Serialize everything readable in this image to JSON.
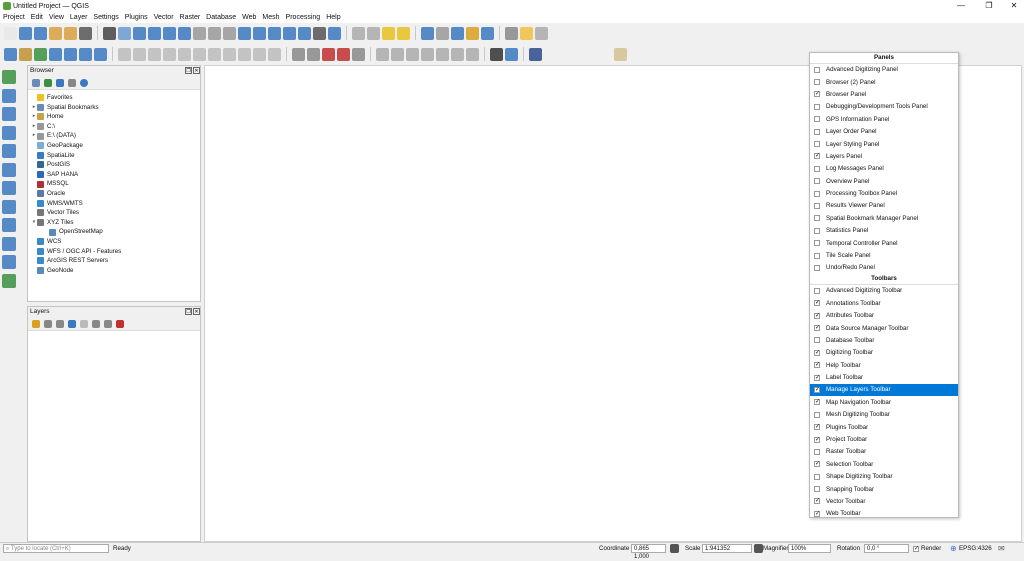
{
  "window": {
    "title": "Untitled Project — QGIS",
    "min": "—",
    "max": "❐",
    "close": "✕"
  },
  "menu": [
    "Project",
    "Edit",
    "View",
    "Layer",
    "Settings",
    "Plugins",
    "Vector",
    "Raster",
    "Database",
    "Web",
    "Mesh",
    "Processing",
    "Help"
  ],
  "browser": {
    "title": "Browser",
    "items": [
      {
        "label": "Favorites",
        "icon": "star-icon",
        "color": "#f0c020",
        "indent": 0,
        "arrow": ""
      },
      {
        "label": "Spatial Bookmarks",
        "icon": "bookmark-icon",
        "color": "#6a8ab8",
        "indent": 0,
        "arrow": "▸"
      },
      {
        "label": "Home",
        "icon": "home-folder-icon",
        "color": "#c8a050",
        "indent": 0,
        "arrow": "▸"
      },
      {
        "label": "C:\\",
        "icon": "drive-icon",
        "color": "#999999",
        "indent": 0,
        "arrow": "▸"
      },
      {
        "label": "E:\\ (DATA)",
        "icon": "drive-icon",
        "color": "#999999",
        "indent": 0,
        "arrow": "▸"
      },
      {
        "label": "GeoPackage",
        "icon": "geopackage-icon",
        "color": "#7ab0d8",
        "indent": 0,
        "arrow": ""
      },
      {
        "label": "SpatiaLite",
        "icon": "spatialite-icon",
        "color": "#3a7abf",
        "indent": 0,
        "arrow": ""
      },
      {
        "label": "PostGIS",
        "icon": "postgis-icon",
        "color": "#336791",
        "indent": 0,
        "arrow": ""
      },
      {
        "label": "SAP HANA",
        "icon": "sap-hana-icon",
        "color": "#2a6ab8",
        "indent": 0,
        "arrow": ""
      },
      {
        "label": "MSSQL",
        "icon": "mssql-icon",
        "color": "#b03030",
        "indent": 0,
        "arrow": ""
      },
      {
        "label": "Oracle",
        "icon": "oracle-icon",
        "color": "#5a7aa8",
        "indent": 0,
        "arrow": ""
      },
      {
        "label": "WMS/WMTS",
        "icon": "wms-icon",
        "color": "#3a8ac8",
        "indent": 0,
        "arrow": ""
      },
      {
        "label": "Vector Tiles",
        "icon": "vector-tiles-icon",
        "color": "#777777",
        "indent": 0,
        "arrow": ""
      },
      {
        "label": "XYZ Tiles",
        "icon": "xyz-tiles-icon",
        "color": "#777777",
        "indent": 0,
        "arrow": "▾"
      },
      {
        "label": "OpenStreetMap",
        "icon": "tile-icon",
        "color": "#5a8ab8",
        "indent": 1,
        "arrow": ""
      },
      {
        "label": "WCS",
        "icon": "wcs-icon",
        "color": "#3a8ac8",
        "indent": 0,
        "arrow": ""
      },
      {
        "label": "WFS / OGC API - Features",
        "icon": "wfs-icon",
        "color": "#3a8ac8",
        "indent": 0,
        "arrow": ""
      },
      {
        "label": "ArcGIS REST Servers",
        "icon": "arcgis-icon",
        "color": "#3a8ac8",
        "indent": 0,
        "arrow": ""
      },
      {
        "label": "GeoNode",
        "icon": "geonode-icon",
        "color": "#5a8ab8",
        "indent": 0,
        "arrow": ""
      }
    ]
  },
  "layers": {
    "title": "Layers"
  },
  "panels": {
    "header": "Panels",
    "items": [
      {
        "label": "Advanced Digitizing Panel",
        "checked": false
      },
      {
        "label": "Browser (2) Panel",
        "checked": false
      },
      {
        "label": "Browser Panel",
        "checked": true
      },
      {
        "label": "Debugging/Development Tools Panel",
        "checked": false
      },
      {
        "label": "GPS Information Panel",
        "checked": false
      },
      {
        "label": "Layer Order Panel",
        "checked": false
      },
      {
        "label": "Layer Styling Panel",
        "checked": false
      },
      {
        "label": "Layers Panel",
        "checked": true
      },
      {
        "label": "Log Messages Panel",
        "checked": false
      },
      {
        "label": "Overview Panel",
        "checked": false
      },
      {
        "label": "Processing Toolbox Panel",
        "checked": false
      },
      {
        "label": "Results Viewer Panel",
        "checked": false
      },
      {
        "label": "Spatial Bookmark Manager Panel",
        "checked": false
      },
      {
        "label": "Statistics Panel",
        "checked": false
      },
      {
        "label": "Temporal Controller Panel",
        "checked": false
      },
      {
        "label": "Tile Scale Panel",
        "checked": false
      },
      {
        "label": "Undo/Redo Panel",
        "checked": false
      }
    ]
  },
  "toolbars": {
    "header": "Toolbars",
    "items": [
      {
        "label": "Advanced Digitizing Toolbar",
        "checked": false
      },
      {
        "label": "Annotations Toolbar",
        "checked": true
      },
      {
        "label": "Attributes Toolbar",
        "checked": true
      },
      {
        "label": "Data Source Manager Toolbar",
        "checked": true
      },
      {
        "label": "Database Toolbar",
        "checked": false
      },
      {
        "label": "Digitizing Toolbar",
        "checked": true
      },
      {
        "label": "Help Toolbar",
        "checked": true
      },
      {
        "label": "Label Toolbar",
        "checked": true
      },
      {
        "label": "Manage Layers Toolbar",
        "checked": true,
        "highlight": true
      },
      {
        "label": "Map Navigation Toolbar",
        "checked": true
      },
      {
        "label": "Mesh Digitizing Toolbar",
        "checked": false
      },
      {
        "label": "Plugins Toolbar",
        "checked": true
      },
      {
        "label": "Project Toolbar",
        "checked": true
      },
      {
        "label": "Raster Toolbar",
        "checked": false
      },
      {
        "label": "Selection Toolbar",
        "checked": true
      },
      {
        "label": "Shape Digitizing Toolbar",
        "checked": false
      },
      {
        "label": "Snapping Toolbar",
        "checked": false
      },
      {
        "label": "Vector Toolbar",
        "checked": true
      },
      {
        "label": "Web Toolbar",
        "checked": true
      }
    ]
  },
  "status": {
    "search_placeholder": "Type to locate (Ctrl+K)",
    "ready": "Ready",
    "coord_label": "Coordinate",
    "coord": "0,865 1,000",
    "scale_label": "Scale",
    "scale": "1:941352",
    "magnifier_label": "Magnifier",
    "magnifier": "100%",
    "rotation_label": "Rotation",
    "rotation": "0,0 °",
    "render_label": "Render",
    "crs": "EPSG:4326"
  },
  "toolbar1": [
    "#e8e8e8",
    "#3a78c0",
    "#3a78c0",
    "#d8a040",
    "#d8a040",
    "#555555",
    "sep",
    "#444444",
    "#6a9ad0",
    "#3a78c0",
    "#3a78c0",
    "#3a78c0",
    "#3a78c0",
    "#999999",
    "#999999",
    "#999999",
    "#3a78c0",
    "#3a78c0",
    "#3a78c0",
    "#3a78c0",
    "#3a78c0",
    "#555555",
    "#3a78c0",
    "sep",
    "#aaaaaa",
    "#aaaaaa",
    "#e8c020",
    "#e8c020",
    "sep",
    "#3a78c0",
    "#999999",
    "#3a78c0",
    "#d8a020",
    "#3a78c0",
    "sep",
    "#888888",
    "#f0c040",
    "#aaaaaa"
  ],
  "toolbar2": [
    "#3a78c0",
    "#c09030",
    "#3a9040",
    "#3a78c0",
    "#3a78c0",
    "#3a78c0",
    "#3a78c0",
    "sep",
    "#bbbbbb",
    "#bbbbbb",
    "#bbbbbb",
    "#bbbbbb",
    "#bbbbbb",
    "#bbbbbb",
    "#bbbbbb",
    "#bbbbbb",
    "#bbbbbb",
    "#bbbbbb",
    "#bbbbbb",
    "sep",
    "#888888",
    "#888888",
    "#c03030",
    "#c03030",
    "#888888",
    "sep",
    "#aaaaaa",
    "#aaaaaa",
    "#aaaaaa",
    "#aaaaaa",
    "#aaaaaa",
    "#aaaaaa",
    "#aaaaaa",
    "sep",
    "#333333",
    "#3a78c0",
    "sep",
    "#2a4a8a"
  ],
  "left_toolbar": [
    "#3a9040",
    "#3a78c0",
    "#3a78c0",
    "#3a78c0",
    "#3a78c0",
    "#3a78c0",
    "#3a78c0",
    "#3a78c0",
    "#3a78c0",
    "#3a78c0",
    "#3a78c0",
    "#3a9040"
  ]
}
